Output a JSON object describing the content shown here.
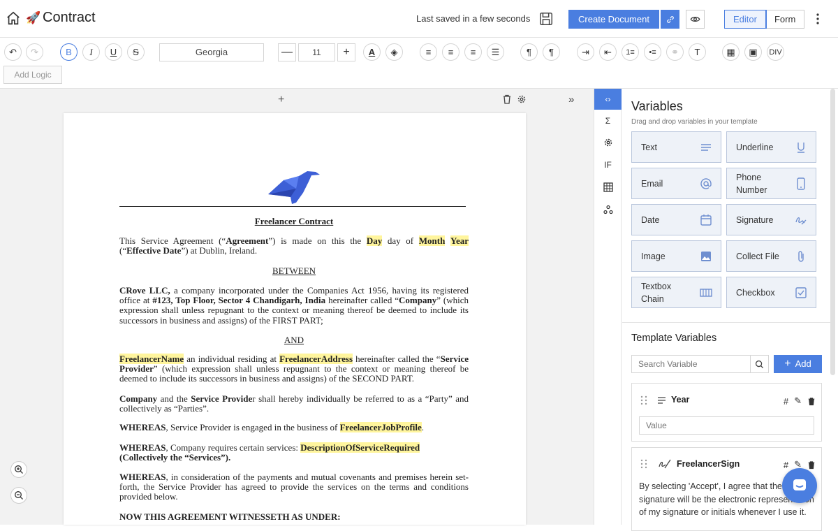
{
  "header": {
    "title": "Contract",
    "saved_status": "Last saved in a few seconds",
    "create_label": "Create Document",
    "modes": [
      "Editor",
      "Form"
    ]
  },
  "toolbar": {
    "font": "Georgia",
    "size": "11",
    "add_logic": "Add Logic",
    "div_label": "DIV"
  },
  "document": {
    "title": "Freelancer Contract",
    "para1": {
      "a": "This Service Agreement (“",
      "b": "Agreement",
      "c": "”) is made on this the ",
      "day": "Day",
      "d": " day of ",
      "month": "Month",
      "year": "Year",
      "e": " (“",
      "f": "Effective Date",
      "g": "”) at Dublin, Ireland."
    },
    "between": "BETWEEN",
    "para2": {
      "a": "CRove LLC,",
      "b": " a company incorporated under the Companies Act 1956, having its registered office at ",
      "c": "#123, Top Floor, Sector 4 Chandigarh, India",
      "d": " hereinafter called “",
      "e": "Company",
      "f": "” (which expression shall unless repugnant to the context or meaning thereof be deemed to include its successors in business and assigns) of the FIRST PART;"
    },
    "and": "AND",
    "para3": {
      "name": "FreelancerName",
      "a": "  an individual residing at ",
      "address": "FreelancerAddress",
      "b": " hereinafter called the “",
      "c": "Service Provider",
      "d": "” (which expression shall unless repugnant to the context or meaning thereof be deemed to include its successors in business and assigns) of the SECOND PART."
    },
    "para4": {
      "a": "Company",
      "b": " and the ",
      "c": "Service Provide",
      "d": "r shall hereby individually be referred to as a “Party” and collectively as “Parties”."
    },
    "para5": {
      "a": "WHEREAS",
      "b": ", Service Provider is engaged in the business of ",
      "c": "FreelancerJobProfile",
      "d": "."
    },
    "para6": {
      "a": "WHEREAS",
      "b": ", Company requires certain services: ",
      "c": "DescriptionOfServiceRequired",
      "d": "(Collectively the “Services”)."
    },
    "para7": {
      "a": "WHEREAS",
      "b": ", in consideration of the payments and mutual covenants and premises herein set-forth, the Service Provider has agreed to provide the services on the terms and conditions provided below."
    },
    "para8": "NOW THIS AGREEMENT WITNESSETH AS UNDER:"
  },
  "rail": {
    "sigma": "Σ",
    "if": "IF"
  },
  "variables": {
    "title": "Variables",
    "subtitle": "Drag and drop variables in your template",
    "items": [
      {
        "label": "Text",
        "icon": "text-lines-icon"
      },
      {
        "label": "Underline",
        "icon": "underline-icon"
      },
      {
        "label": "Email",
        "icon": "at-icon"
      },
      {
        "label": "Phone Number",
        "icon": "phone-icon"
      },
      {
        "label": "Date",
        "icon": "calendar-icon"
      },
      {
        "label": "Signature",
        "icon": "signature-icon"
      },
      {
        "label": "Image",
        "icon": "image-icon"
      },
      {
        "label": "Collect File",
        "icon": "paperclip-icon"
      },
      {
        "label": "Textbox Chain",
        "icon": "chain-icon"
      },
      {
        "label": "Checkbox",
        "icon": "checkbox-icon"
      }
    ]
  },
  "template_variables": {
    "title": "Template Variables",
    "search_placeholder": "Search Variable",
    "add_label": "Add",
    "items": [
      {
        "name": "Year",
        "value_placeholder": "Value"
      },
      {
        "name": "FreelancerSign",
        "consent": "By selecting 'Accept', I agree that the signature will be the electronic representation of my signature or initials whenever I use it."
      }
    ]
  },
  "colors": {
    "accent": "#4a7ee0",
    "highlight": "#fff59d",
    "card_bg": "#eef2f8"
  }
}
